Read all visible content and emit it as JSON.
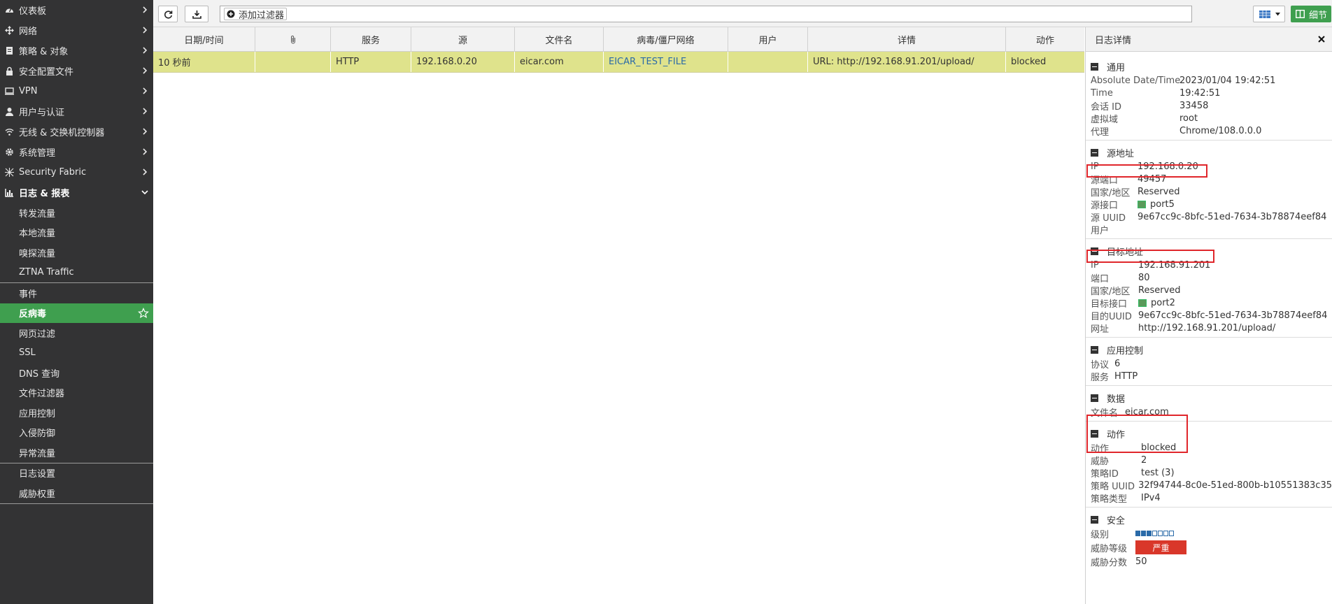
{
  "sidebar": {
    "items": [
      {
        "label": "仪表板",
        "icon": "dashboard-icon"
      },
      {
        "label": "网络",
        "icon": "network-icon"
      },
      {
        "label": "策略 & 对象",
        "icon": "policy-icon"
      },
      {
        "label": "安全配置文件",
        "icon": "lock-icon"
      },
      {
        "label": "VPN",
        "icon": "vpn-icon"
      },
      {
        "label": "用户与认证",
        "icon": "user-icon"
      },
      {
        "label": "无线 & 交换机控制器",
        "icon": "wifi-icon"
      },
      {
        "label": "系统管理",
        "icon": "gear-icon"
      },
      {
        "label": "Security Fabric",
        "icon": "fabric-icon"
      },
      {
        "label": "日志 & 报表",
        "icon": "chart-icon"
      }
    ],
    "log_sub": {
      "group1": [
        "转发流量",
        "本地流量",
        "嗅探流量",
        "ZTNA Traffic"
      ],
      "group2": [
        "事件",
        "反病毒",
        "网页过滤",
        "SSL",
        "DNS 查询",
        "文件过滤器",
        "应用控制",
        "入侵防御",
        "异常流量"
      ],
      "group3": [
        "日志设置",
        "威胁权重"
      ]
    }
  },
  "toolbar": {
    "filter_add_label": "添加过滤器",
    "detail_label": "细节"
  },
  "table": {
    "headers": [
      "日期/时间",
      "",
      "服务",
      "源",
      "文件名",
      "病毒/僵尸网络",
      "用户",
      "详情",
      "动作"
    ],
    "rows": [
      [
        "10 秒前",
        "",
        "HTTP",
        "192.168.0.20",
        "eicar.com",
        "EICAR_TEST_FILE",
        "",
        "URL: http://192.168.91.201/upload/",
        "blocked"
      ]
    ]
  },
  "panel": {
    "title": "日志详情",
    "general": {
      "title": "通用",
      "rows": [
        {
          "k": "Absolute Date/Time",
          "v": "2023/01/04 19:42:51"
        },
        {
          "k": "Time",
          "v": "19:42:51"
        },
        {
          "k": "会话 ID",
          "v": "33458"
        },
        {
          "k": "虚拟域",
          "v": "root"
        },
        {
          "k": "代理",
          "v": "Chrome/108.0.0.0"
        }
      ]
    },
    "source": {
      "title": "源地址",
      "rows": [
        {
          "k": "IP",
          "v": "192.168.0.20"
        },
        {
          "k": "源端口",
          "v": "49457"
        },
        {
          "k": "国家/地区",
          "v": "Reserved"
        },
        {
          "k": "源接口",
          "v": "port5"
        },
        {
          "k": "源 UUID",
          "v": "9e67cc9c-8bfc-51ed-7634-3b78874eef84"
        },
        {
          "k": "用户",
          "v": ""
        }
      ]
    },
    "dest": {
      "title": "目标地址",
      "rows": [
        {
          "k": "IP",
          "v": "192.168.91.201"
        },
        {
          "k": "端口",
          "v": "80"
        },
        {
          "k": "国家/地区",
          "v": "Reserved"
        },
        {
          "k": "目标接口",
          "v": "port2"
        },
        {
          "k": "目的UUID",
          "v": "9e67cc9c-8bfc-51ed-7634-3b78874eef84"
        },
        {
          "k": "网址",
          "v": "http://192.168.91.201/upload/"
        }
      ]
    },
    "app": {
      "title": "应用控制",
      "rows": [
        {
          "k": "协议",
          "v": "6"
        },
        {
          "k": "服务",
          "v": "HTTP"
        }
      ]
    },
    "data": {
      "title": "数据",
      "rows": [
        {
          "k": "文件名",
          "v": "eicar.com"
        }
      ]
    },
    "action": {
      "title": "动作",
      "rows": [
        {
          "k": "动作",
          "v": "blocked"
        },
        {
          "k": "威胁",
          "v": "2"
        },
        {
          "k": "策略ID",
          "v": "test (3)"
        },
        {
          "k": "策略 UUID",
          "v": "32f94744-8c0e-51ed-800b-b10551383c35"
        },
        {
          "k": "策略类型",
          "v": "IPv4"
        }
      ]
    },
    "security": {
      "title": "安全",
      "level_label": "级别",
      "level_value": 3,
      "level_max": 7,
      "threat_level_label": "威胁等级",
      "threat_level_value": "严重",
      "threat_level_color": "#d9372a",
      "score_label": "威胁分数",
      "score_value": "50"
    }
  }
}
